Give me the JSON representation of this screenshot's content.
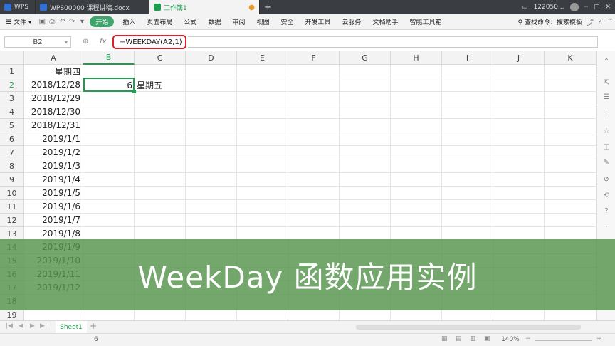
{
  "titlebar": {
    "tabs": [
      {
        "label": "WPS",
        "color": "#2f6fd6",
        "active": false
      },
      {
        "label": "WPS00000 课程讲稿.docx",
        "color": "#2f6fd6",
        "active": false
      },
      {
        "label": "工作簿1",
        "color": "#1e9e4f",
        "active": true
      }
    ],
    "new_tab": "+",
    "user": "122050..."
  },
  "menubar": {
    "file_label": "文件",
    "items": [
      "开始",
      "插入",
      "页面布局",
      "公式",
      "数据",
      "审阅",
      "视图",
      "安全",
      "开发工具",
      "云服务",
      "文档助手",
      "智能工具箱"
    ],
    "search_placeholder": "查找命令、搜索模板"
  },
  "formulabar": {
    "cell_ref": "B2",
    "formula": "=WEEKDAY(A2,1)"
  },
  "grid": {
    "columns": [
      "A",
      "B",
      "C",
      "D",
      "E",
      "F",
      "G",
      "H",
      "I",
      "J",
      "K"
    ],
    "rows": [
      "1",
      "2",
      "3",
      "4",
      "5",
      "6",
      "7",
      "8",
      "9",
      "10",
      "11",
      "12",
      "13",
      "14",
      "15",
      "16",
      "17",
      "18",
      "19"
    ],
    "col_a": [
      "星期四",
      "2018/12/28",
      "2018/12/29",
      "2018/12/30",
      "2018/12/31",
      "2019/1/1",
      "2019/1/2",
      "2019/1/3",
      "2019/1/4",
      "2019/1/5",
      "2019/1/6",
      "2019/1/7",
      "2019/1/8",
      "2019/1/9",
      "2019/1/10",
      "2019/1/11",
      "2019/1/12"
    ],
    "b2": "6",
    "c2": "星期五",
    "selected_col": "B",
    "selected_row": "2",
    "accent": "#1e9e4f"
  },
  "sheetbar": {
    "sheet_name": "Sheet1",
    "add": "+"
  },
  "statusbar": {
    "value": "6",
    "zoom": "140%"
  },
  "overlay": {
    "text": "WeekDay 函数应用实例",
    "color": "#54944c"
  }
}
